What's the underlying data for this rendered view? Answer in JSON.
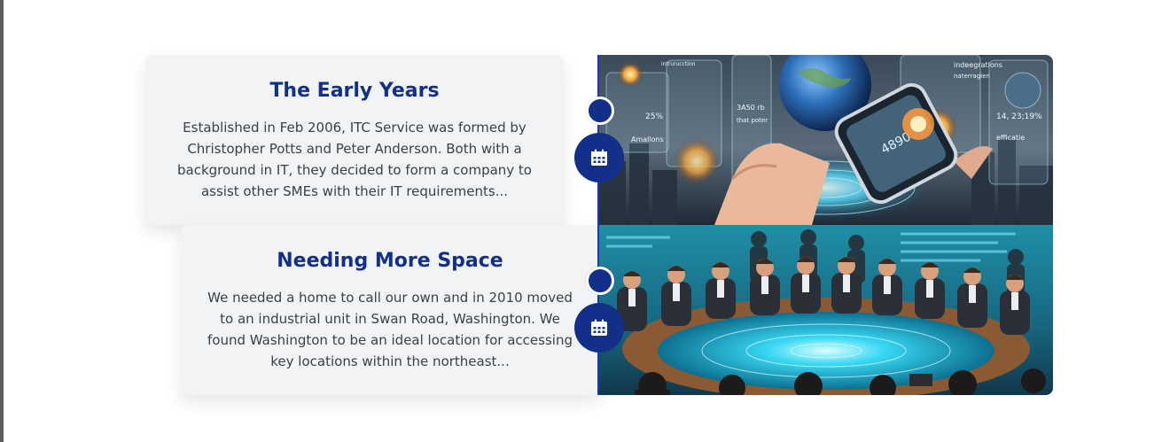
{
  "timeline": {
    "entries": [
      {
        "title": "The Early Years",
        "body": "Established in Feb 2006, ITC Service was formed by Christopher Potts and Peter Anderson. Both with a background in IT, they decided to form a company to assist other SMEs with their IT requirements...",
        "icon": "calendar-icon",
        "image_texts": {
          "a": "25%",
          "b": "Amallons",
          "c": "3A50 rb",
          "d": "that poter",
          "e": "indeegrations",
          "f": "naterragien",
          "g": "14, 23;19%",
          "h": "efficatie",
          "i": "intrurucction",
          "j": "4890"
        }
      },
      {
        "title": "Needing More Space",
        "body": "We needed a home to call our own and in 2010 moved to an industrial unit in Swan Road, Washington. We found Washington to be an ideal location for accessing key locations within the northeast...",
        "icon": "calendar-icon"
      }
    ]
  },
  "colors": {
    "accent": "#12308a",
    "card_bg": "#f2f3f5",
    "text": "#3a3f48"
  }
}
